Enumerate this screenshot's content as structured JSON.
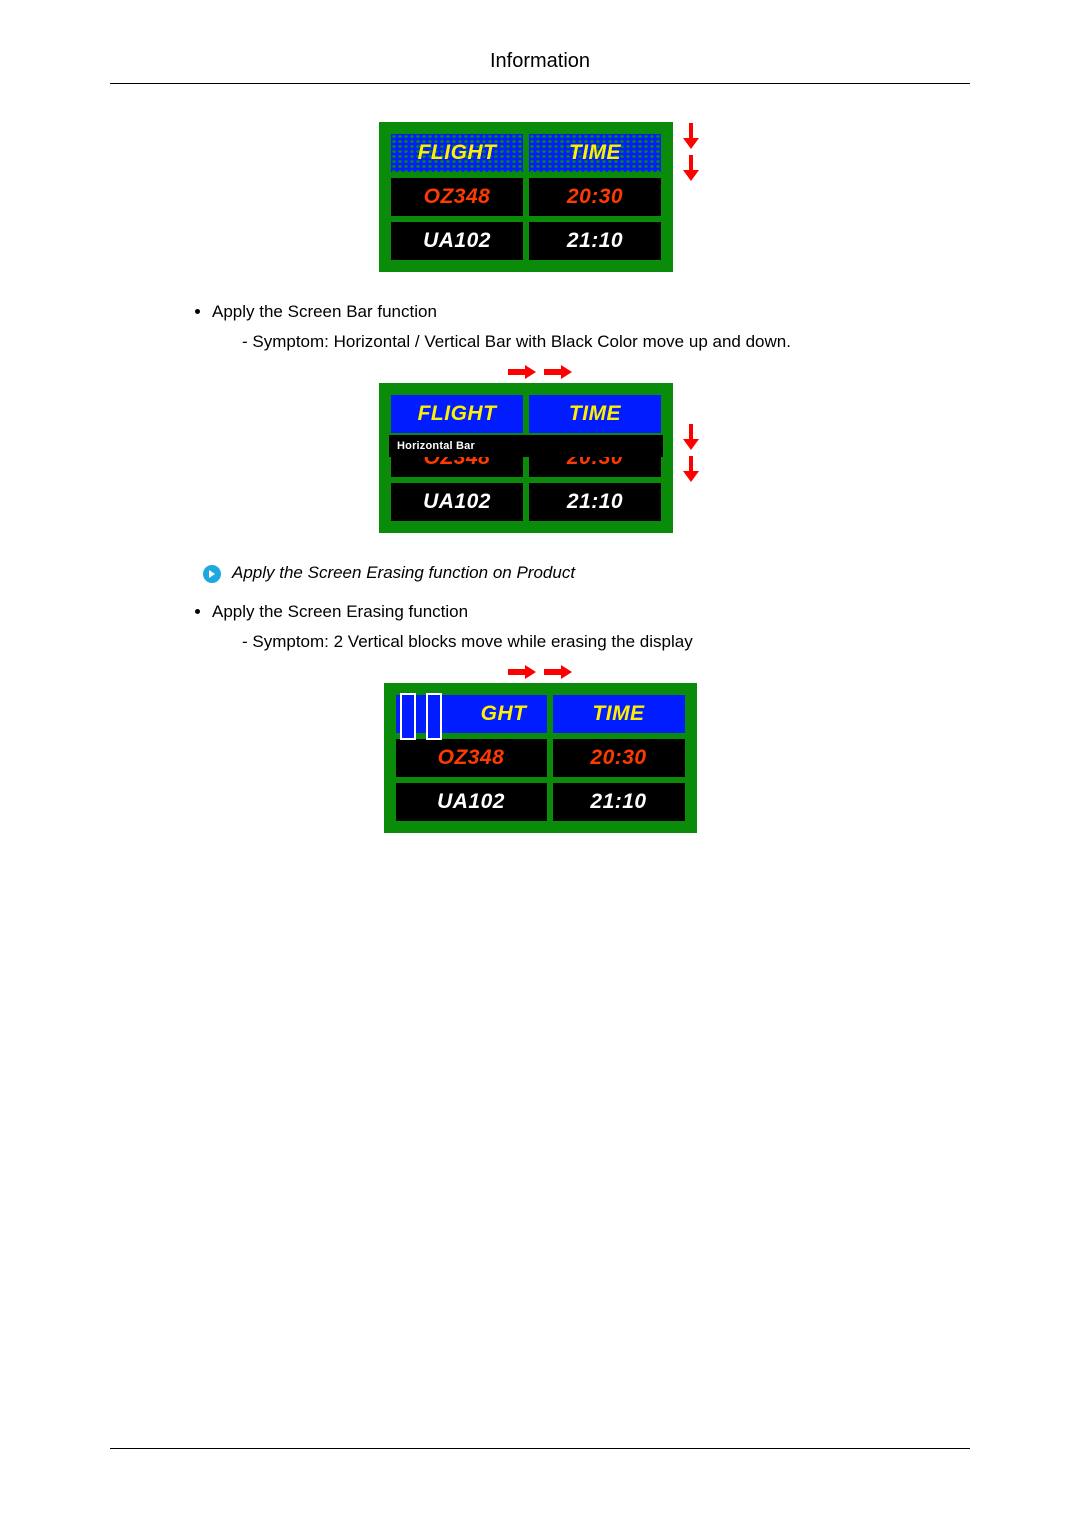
{
  "header": {
    "title": "Information"
  },
  "board": {
    "headers": {
      "flight": "FLIGHT",
      "time": "TIME"
    },
    "rows": [
      {
        "flight": "OZ348",
        "time": "20:30"
      },
      {
        "flight": "UA102",
        "time": "21:10"
      }
    ],
    "bar_label": "Horizontal Bar",
    "erase_header_partial": "GHT"
  },
  "text": {
    "bullet_screen_bar": "Apply the Screen Bar function",
    "symptom_bar": "- Symptom: Horizontal / Vertical Bar with Black Color move up and down.",
    "note_erasing": "Apply the Screen Erasing function on Product",
    "bullet_erasing": "Apply the Screen Erasing function",
    "symptom_erasing": "- Symptom: 2 Vertical blocks move while erasing the display"
  }
}
